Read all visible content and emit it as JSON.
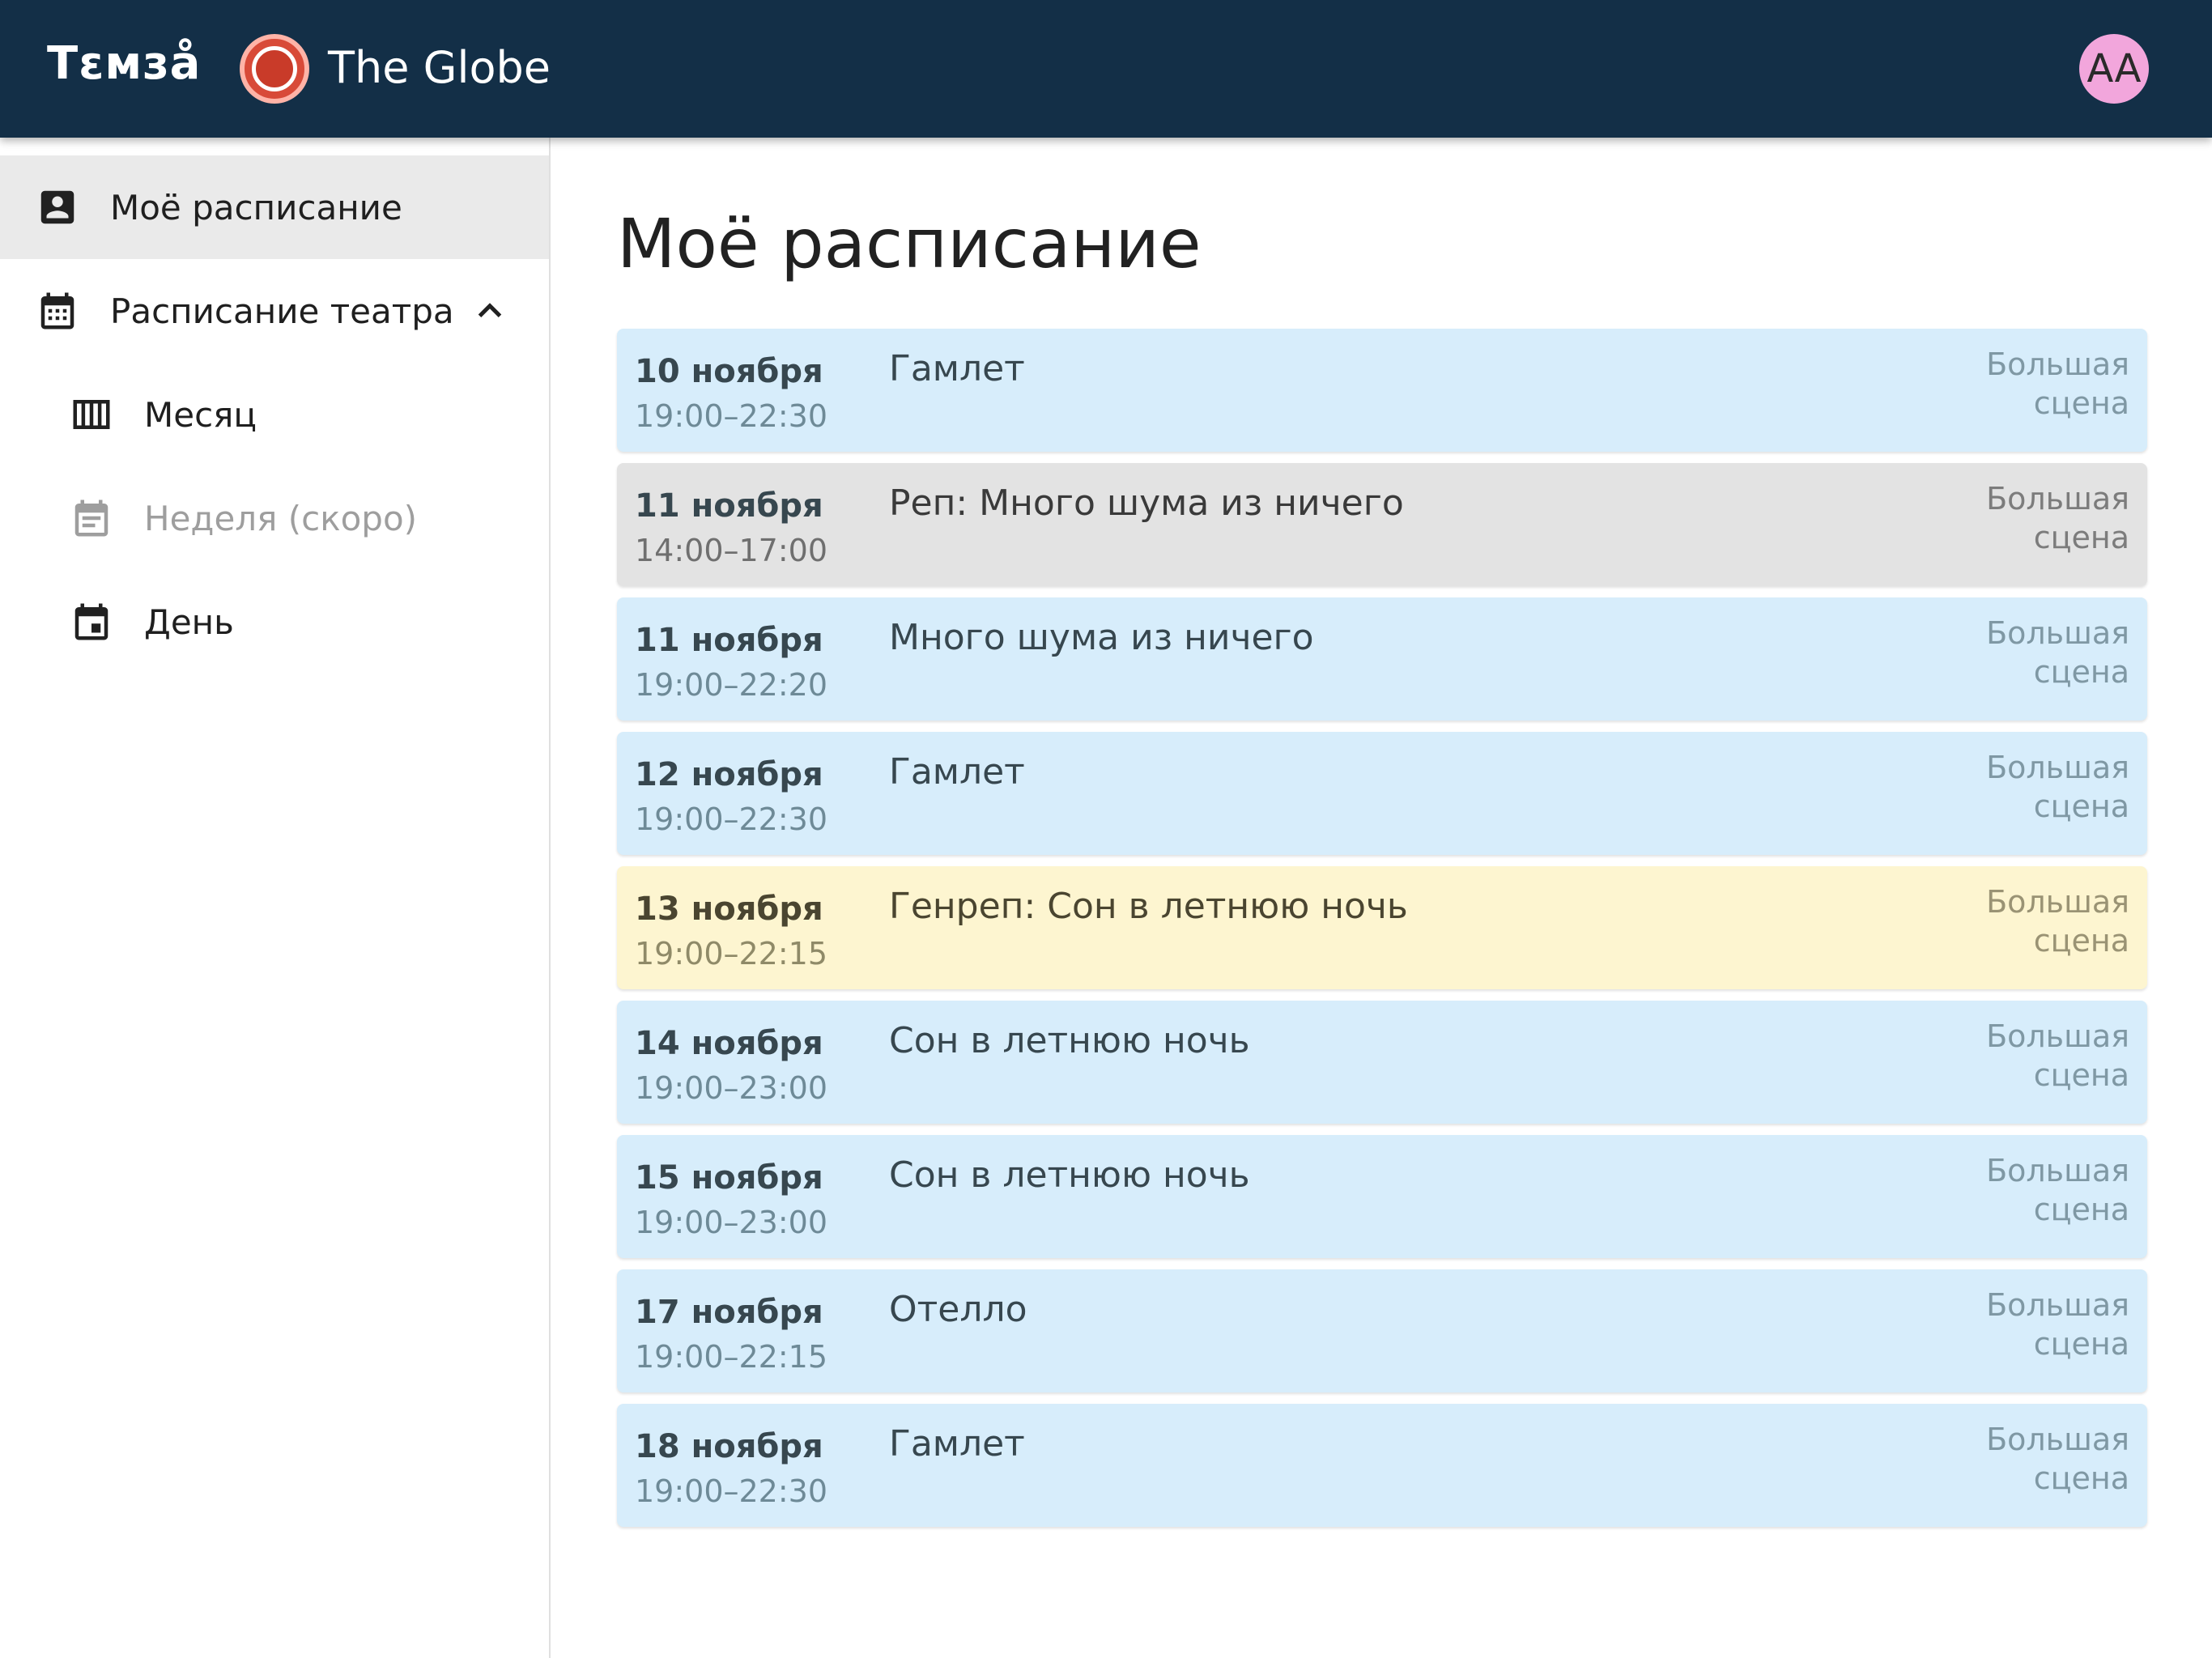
{
  "header": {
    "brand": "Тεмзå",
    "theatre_name": "The Globe",
    "avatar_initials": "AA"
  },
  "sidebar": {
    "items": [
      {
        "label": "Моё расписание",
        "icon": "account-box-icon",
        "active": true
      },
      {
        "label": "Расписание театра",
        "icon": "calendar-month-icon",
        "expanded": true
      },
      {
        "label": "Месяц",
        "icon": "view-week-icon"
      },
      {
        "label": "Неделя (скоро)",
        "icon": "calendar-text-icon",
        "disabled": true
      },
      {
        "label": "День",
        "icon": "calendar-today-icon"
      }
    ]
  },
  "main": {
    "title": "Моё расписание",
    "events": [
      {
        "date": "10 ноября",
        "time": "19:00–22:30",
        "title": "Гамлет",
        "venue_line1": "Большая",
        "venue_line2": "сцена",
        "color": "#d7edfb"
      },
      {
        "date": "11 ноября",
        "time": "14:00–17:00",
        "title": "Реп: Много шума из ничего",
        "venue_line1": "Большая",
        "venue_line2": "сцена",
        "color": "#e3e3e3"
      },
      {
        "date": "11 ноября",
        "time": "19:00–22:20",
        "title": "Много шума из ничего",
        "venue_line1": "Большая",
        "venue_line2": "сцена",
        "color": "#d7edfb"
      },
      {
        "date": "12 ноября",
        "time": "19:00–22:30",
        "title": "Гамлет",
        "venue_line1": "Большая",
        "venue_line2": "сцена",
        "color": "#d7edfb"
      },
      {
        "date": "13 ноября",
        "time": "19:00–22:15",
        "title": "Генреп: Сон в летнюю ночь",
        "venue_line1": "Большая",
        "venue_line2": "сцена",
        "color": "#fdf5d0"
      },
      {
        "date": "14 ноября",
        "time": "19:00–23:00",
        "title": "Сон в летнюю ночь",
        "venue_line1": "Большая",
        "venue_line2": "сцена",
        "color": "#d7edfb"
      },
      {
        "date": "15 ноября",
        "time": "19:00–23:00",
        "title": "Сон в летнюю ночь",
        "venue_line1": "Большая",
        "venue_line2": "сцена",
        "color": "#d7edfb"
      },
      {
        "date": "17 ноября",
        "time": "19:00–22:15",
        "title": "Отелло",
        "venue_line1": "Большая",
        "venue_line2": "сцена",
        "color": "#d7edfb"
      },
      {
        "date": "18 ноября",
        "time": "19:00–22:30",
        "title": "Гамлет",
        "venue_line1": "Большая",
        "venue_line2": "сцена",
        "color": "#d7edfb"
      }
    ]
  },
  "colors": {
    "appbar": "#132f47",
    "avatar": "#f2a6dc",
    "theatre_logo": "#d84a38",
    "rehearsal": "#e3e3e3",
    "dress_rehearsal": "#fdf5d0",
    "performance": "#d7edfb"
  }
}
